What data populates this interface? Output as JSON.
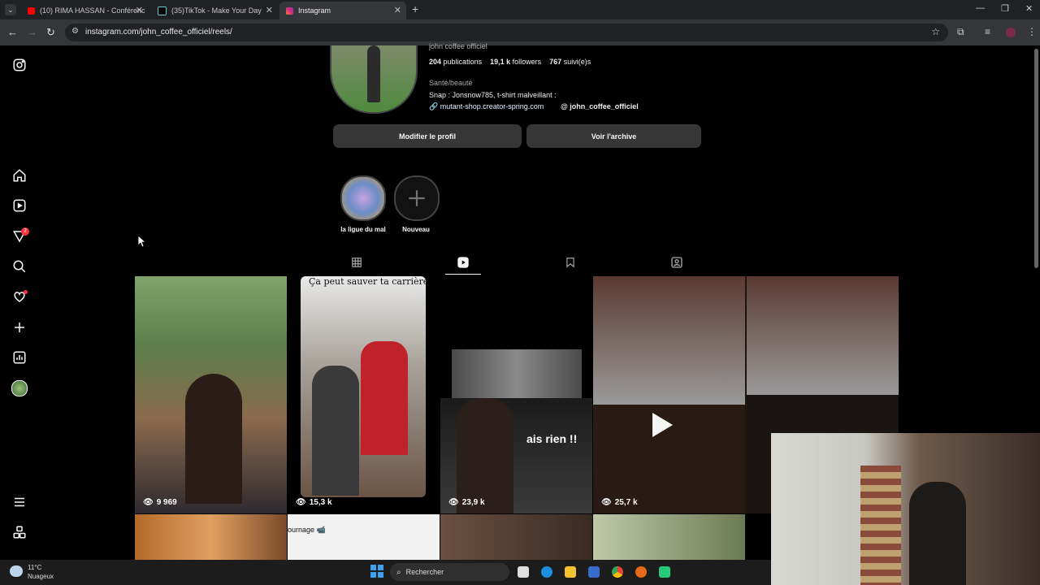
{
  "browser": {
    "tabs": [
      {
        "title": "(10) RIMA HASSAN - Conférenc",
        "color": "#ff0000"
      },
      {
        "title": "(35)TikTok - Make Your Day",
        "color": "#111111"
      },
      {
        "title": "Instagram",
        "color": "#e1306c",
        "active": true
      }
    ],
    "new_tab": "+",
    "url": "instagram.com/john_coffee_officiel/reels/"
  },
  "sidebar": {
    "icons": [
      "instagram-icon",
      "home-icon",
      "reels-icon",
      "explore-icon",
      "search-icon",
      "heart-icon",
      "create-icon",
      "dashboard-icon",
      "profile-avatar",
      "menu-icon",
      "threads-icon"
    ],
    "notification_count": "2"
  },
  "profile": {
    "username": "john coffee officiel",
    "stats": {
      "publications_count": "204",
      "publications_label": "publications",
      "followers_count": "19,1 k",
      "followers_label": "followers",
      "following_count": "767",
      "following_label": "suivi(e)s"
    },
    "category": "Santé/beauté",
    "bio": "Snap : Jonsnow785, t-shirt malveillant :",
    "link": "mutant-shop.creator-spring.com",
    "threads_handle": "john_coffee_officiel",
    "edit_button": "Modifier le profil",
    "archive_button": "Voir l'archive"
  },
  "highlights": [
    {
      "label": "la ligue du mal"
    },
    {
      "label": "Nouveau"
    }
  ],
  "profile_tabs": [
    "posts-grid",
    "reels",
    "saved",
    "tagged"
  ],
  "active_tab": "reels",
  "reels": [
    {
      "views": "9 969"
    },
    {
      "views": "15,3 k",
      "caption": "Ça peut sauver ta carrière"
    },
    {
      "views": "23,9 k",
      "overlay": "ais rien !!"
    },
    {
      "views": "25,7 k"
    }
  ],
  "second_row_caption": "ournage 📹",
  "taskbar": {
    "weather_temp": "11°C",
    "weather_desc": "Nuageux",
    "search_label": "Rechercher"
  }
}
